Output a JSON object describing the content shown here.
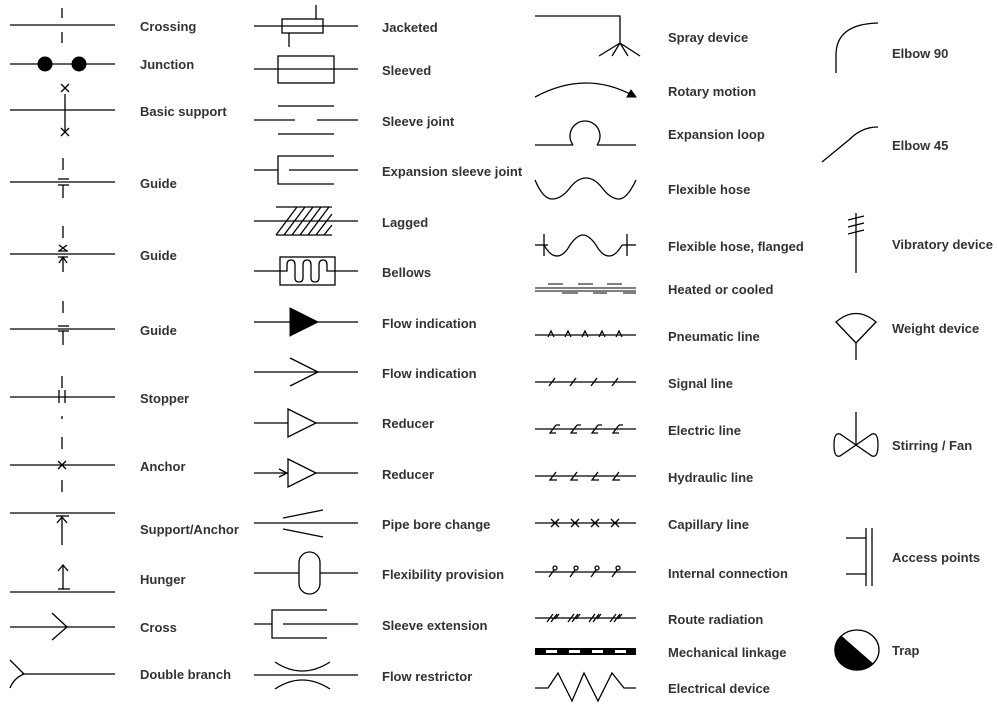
{
  "columns": [
    {
      "labels": [
        "Crossing",
        "Junction",
        "Basic support",
        "Guide",
        "Guide",
        "Guide",
        "Stopper",
        "Anchor",
        "Support/Anchor",
        "Hunger",
        "Cross",
        "Double branch"
      ]
    },
    {
      "labels": [
        "Jacketed",
        "Sleeved",
        "Sleeve joint",
        "Expansion sleeve joint",
        "Lagged",
        "Bellows",
        "Flow indication",
        "Flow indication",
        "Reducer",
        "Reducer",
        "Pipe bore change",
        "Flexibility provision",
        "Sleeve extension",
        "Flow restrictor"
      ]
    },
    {
      "labels": [
        "Spray device",
        "Rotary motion",
        "Expansion loop",
        "Flexible hose",
        "Flexible hose, flanged",
        "Heated or cooled",
        "Pneumatic line",
        "Signal line",
        "Electric line",
        "Hydraulic line",
        "Capillary line",
        "Internal connection",
        "Route radiation",
        "Mechanical linkage",
        "Electrical device"
      ]
    },
    {
      "labels": [
        "Elbow 90",
        "Elbow 45",
        "Vibratory device",
        "Weight device",
        "Stirring / Fan",
        "Access points",
        "Trap"
      ]
    }
  ],
  "colors": {
    "symbol": "#000000",
    "label": "#333333",
    "background": "#ffffff"
  }
}
